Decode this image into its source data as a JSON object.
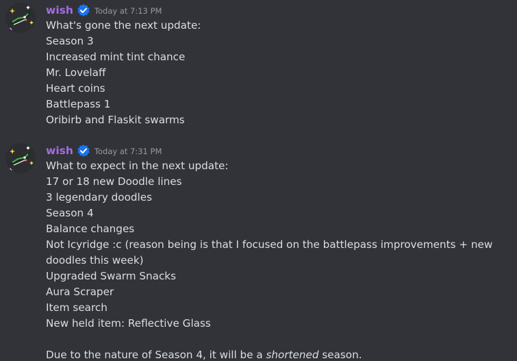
{
  "theme": {
    "background": "#313338",
    "text": "#dbdee1",
    "muted": "#949ba4",
    "username_color": "#a56de2",
    "verified_color": "#1d73ec"
  },
  "messages": [
    {
      "author": "wish",
      "timestamp": "Today at 7:13 PM",
      "verified_icon": "verified-badge-icon",
      "lines": [
        "What's gone the next update:",
        "Season 3",
        "Increased mint tint chance",
        "Mr. Lovelaff",
        "Heart coins",
        "Battlepass 1",
        "Oribirb and Flaskit swarms"
      ]
    },
    {
      "author": "wish",
      "timestamp": "Today at 7:31 PM",
      "verified_icon": "verified-badge-icon",
      "lines": [
        "What to expect in the next update:",
        "17 or 18 new Doodle lines",
        "3 legendary doodles",
        "Season 4",
        "Balance changes",
        "Not Icyridge :c (reason being is that I focused on the battlepass improvements + new doodles this week)",
        "Upgraded Swarm Snacks",
        "Aura Scraper",
        "Item search",
        "New held item: Reflective Glass"
      ],
      "closing": {
        "before": "Due to the nature of Season 4, it will be a ",
        "emphasis": "shortened",
        "after": " season."
      }
    }
  ]
}
